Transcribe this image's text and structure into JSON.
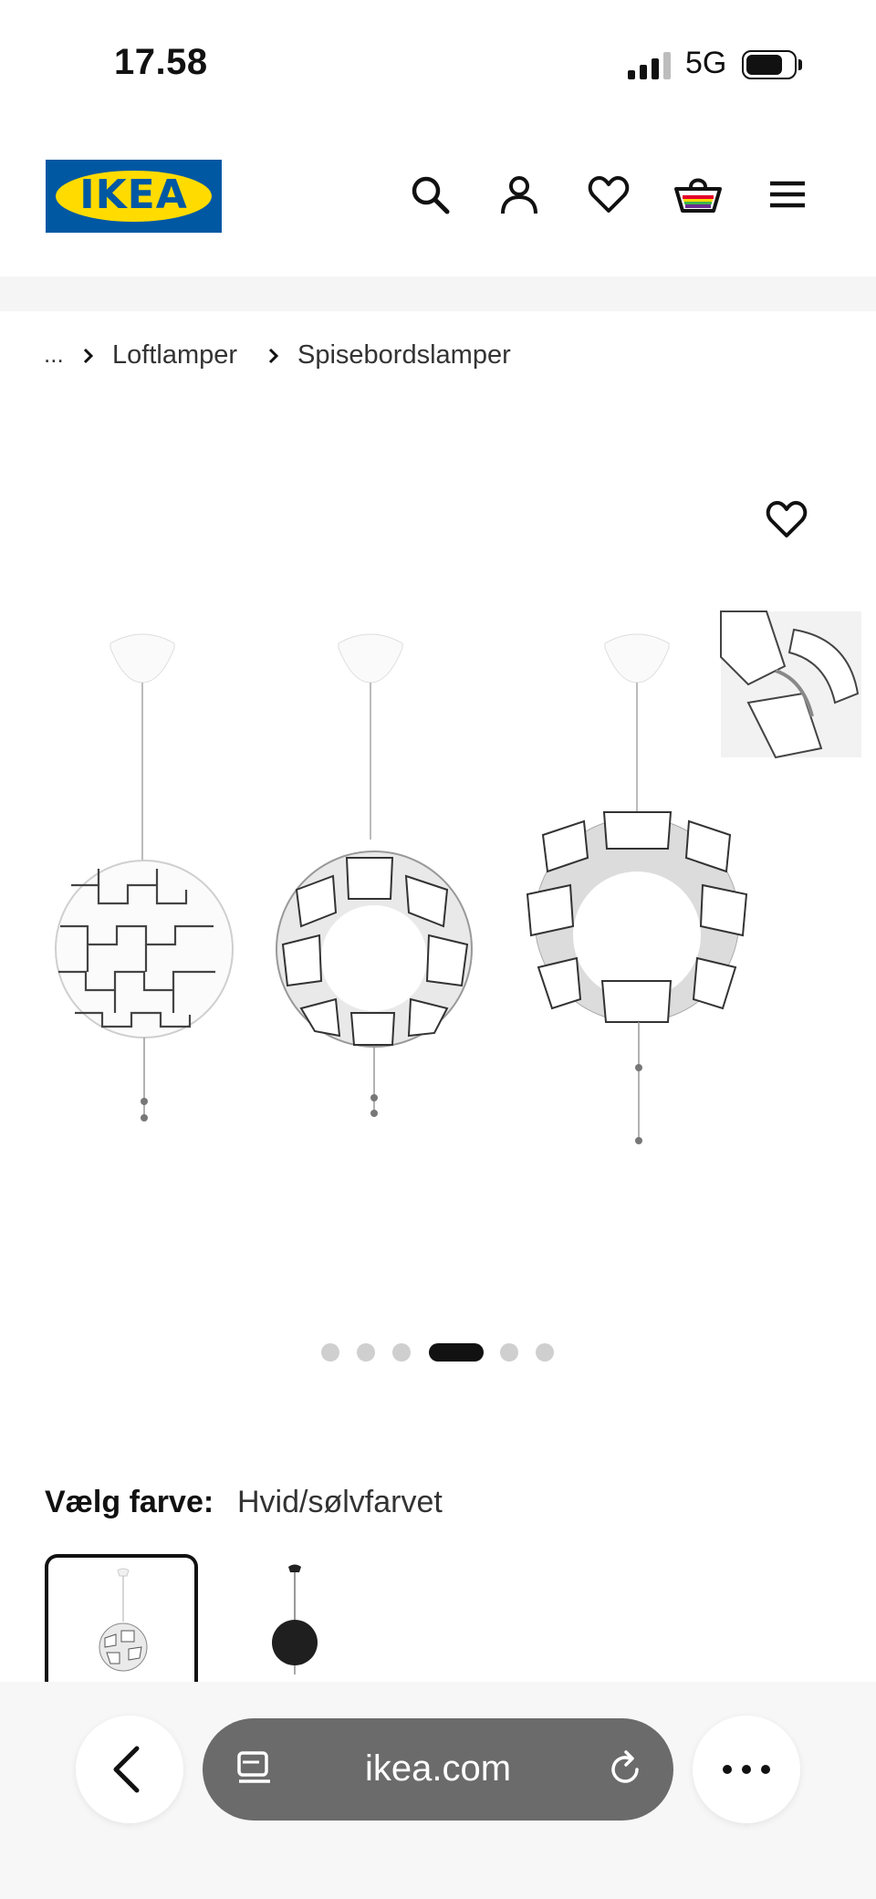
{
  "status_bar": {
    "time": "17.58",
    "network": "5G"
  },
  "header": {
    "logo_text": "IKEA",
    "icons": [
      "search-icon",
      "account-icon",
      "heart-icon",
      "shopping-bag-icon",
      "menu-icon"
    ]
  },
  "breadcrumb": {
    "ellipsis": "...",
    "items": [
      "Loftlamper",
      "Spisebordslamper"
    ]
  },
  "gallery": {
    "dot_count": 6,
    "active_index": 3
  },
  "color_picker": {
    "label": "Vælg farve:",
    "selected": "Hvid/sølvfarvet",
    "options": [
      "white-silver",
      "black"
    ]
  },
  "browser": {
    "url": "ikea.com",
    "icons": [
      "back-icon",
      "tabs-icon",
      "reload-icon",
      "more-icon"
    ]
  },
  "colors": {
    "ikea_blue": "#0058a3",
    "ikea_yellow": "#ffdb00",
    "url_bar": "#6b6b6b"
  }
}
